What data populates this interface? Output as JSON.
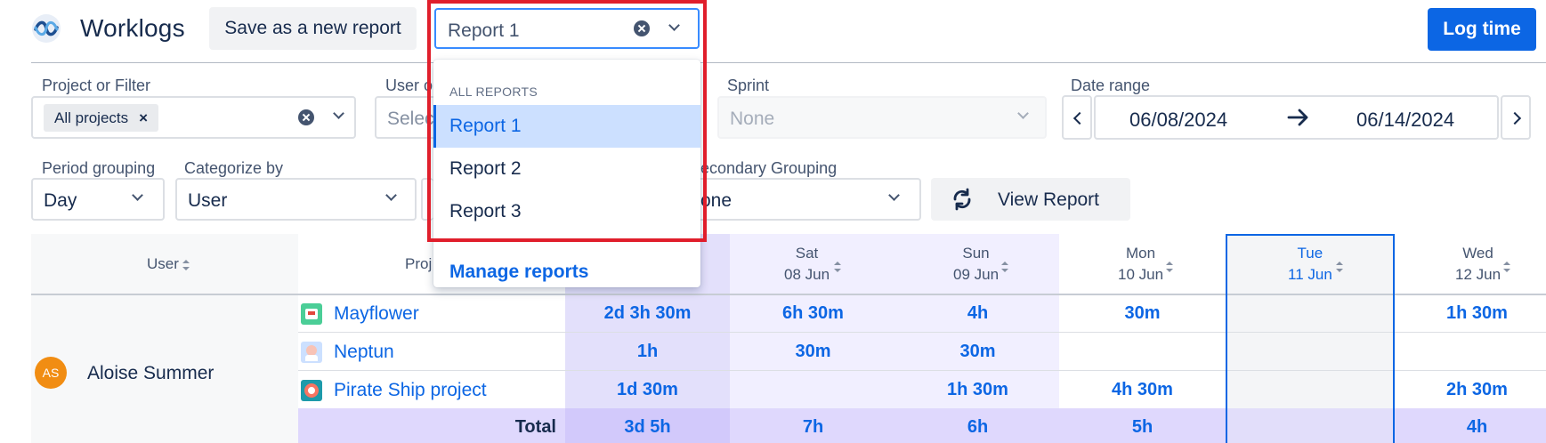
{
  "header": {
    "title": "Worklogs",
    "save_button": "Save as a new report",
    "report_select_value": "Report 1",
    "log_time_button": "Log time"
  },
  "filters": {
    "project_label": "Project or Filter",
    "project_tag": "All projects",
    "user_label": "User o",
    "user_placeholder": "Selec",
    "sprint_label": "Sprint",
    "sprint_value": "None",
    "date_range_label": "Date range",
    "date_from": "06/08/2024",
    "date_to": "06/14/2024",
    "period_label": "Period grouping",
    "period_value": "Day",
    "categorize_label": "Categorize by",
    "categorize_value": "User",
    "secondary_label": "econdary Grouping",
    "secondary_value": "one",
    "view_report_button": "View Report"
  },
  "dropdown": {
    "group_label": "ALL REPORTS",
    "items": [
      "Report 1",
      "Report 2",
      "Report 3"
    ],
    "selected": "Report 1",
    "manage_link": "Manage reports"
  },
  "table": {
    "user_header": "User",
    "project_header": "Proj",
    "days": [
      {
        "day": "Sat",
        "date": "08 Jun"
      },
      {
        "day": "Sun",
        "date": "09 Jun"
      },
      {
        "day": "Mon",
        "date": "10 Jun"
      },
      {
        "day": "Tue",
        "date": "11 Jun"
      },
      {
        "day": "Wed",
        "date": "12 Jun"
      }
    ],
    "user": {
      "initials": "AS",
      "name": "Aloise Summer"
    },
    "projects": [
      {
        "name": "Mayflower",
        "icon": "mayflower-project-icon",
        "values": [
          "2d 3h 30m",
          "6h 30m",
          "4h",
          "30m",
          "",
          "1h 30m"
        ]
      },
      {
        "name": "Neptun",
        "icon": "neptun-project-icon",
        "values": [
          "1h",
          "30m",
          "30m",
          "",
          "",
          ""
        ]
      },
      {
        "name": "Pirate Ship project",
        "icon": "pirate-ship-project-icon",
        "values": [
          "1d 30m",
          "",
          "1h 30m",
          "4h 30m",
          "",
          "2h 30m"
        ]
      }
    ],
    "total_label": "Total",
    "totals": [
      "3d 5h",
      "7h",
      "6h",
      "5h",
      "",
      "4h"
    ]
  },
  "colors": {
    "primary": "#0c66e4",
    "highlight_border": "#e01e2b",
    "weekend_column": "#f1efff",
    "total_row": "#dfd8fd"
  }
}
